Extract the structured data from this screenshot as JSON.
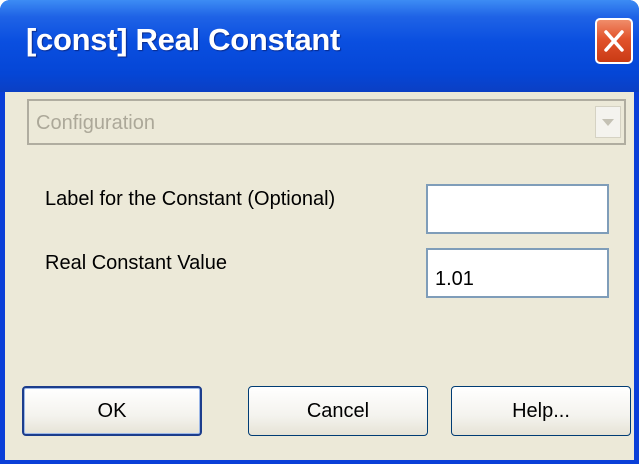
{
  "window": {
    "title": "[const] Real Constant"
  },
  "title_bar": {
    "close_icon": "close-x-icon"
  },
  "configuration": {
    "selected": "Configuration",
    "dropdown_icon": "chevron-down-icon"
  },
  "fields": [
    {
      "label": "Label for the Constant (Optional)",
      "value": ""
    },
    {
      "label": "Real Constant Value",
      "value": "1.01"
    }
  ],
  "buttons": {
    "ok": "OK",
    "cancel": "Cancel",
    "help": "Help..."
  },
  "colors": {
    "title_bar": "#0a4fe0",
    "dialog_background": "#ece9d8",
    "close_button": "#e2532c",
    "field_border": "#7f9db9",
    "disabled_text": "#aca899"
  }
}
